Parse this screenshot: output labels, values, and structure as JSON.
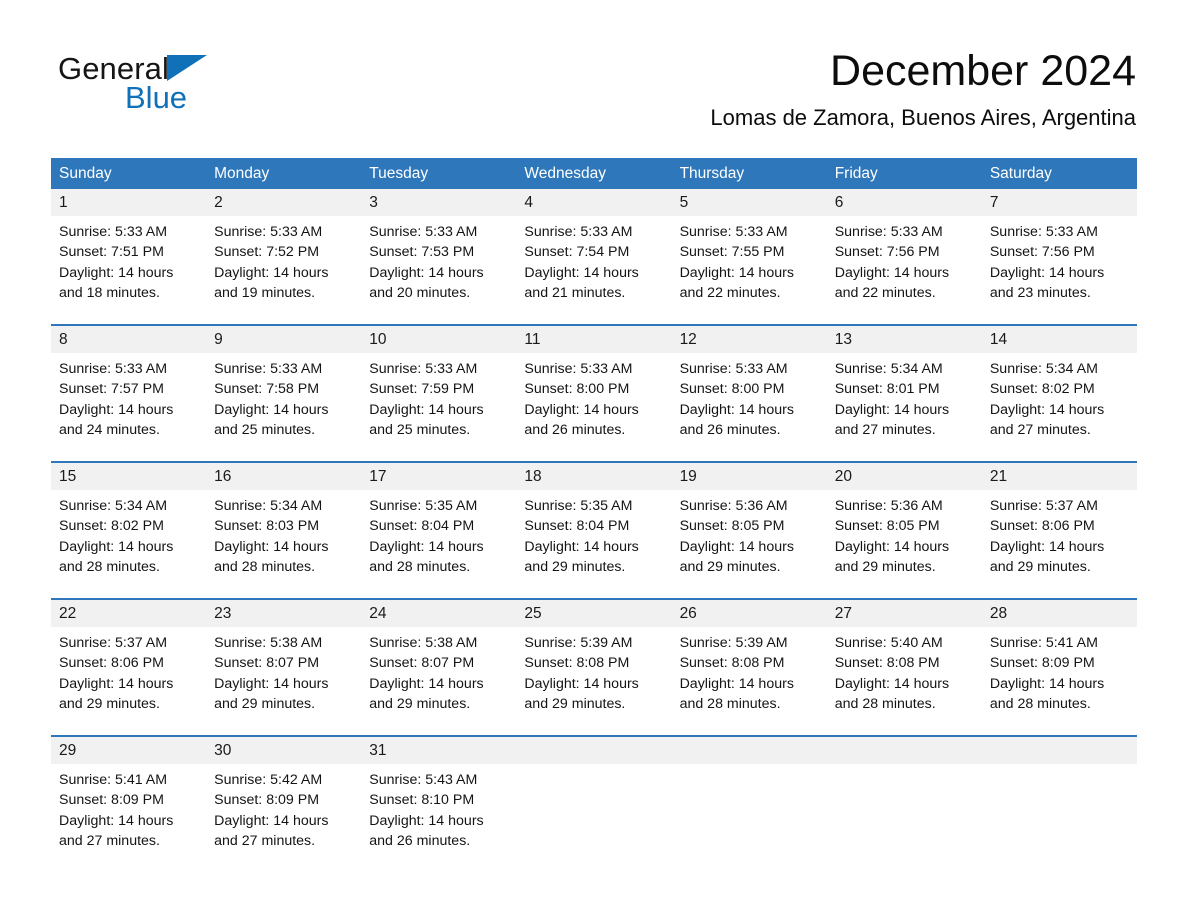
{
  "brand": {
    "name_part1": "General",
    "name_part2": "Blue",
    "triangle_color": "#1071b8",
    "text_color": "#151515"
  },
  "header": {
    "title": "December 2024",
    "subtitle": "Lomas de Zamora, Buenos Aires, Argentina"
  },
  "theme": {
    "header_blue": "#2e77ba",
    "row_separator_blue": "#2e77ba",
    "daynum_band_gray": "#f1f1f1",
    "page_background": "#ffffff",
    "text_color": "#141414"
  },
  "weekdays": [
    "Sunday",
    "Monday",
    "Tuesday",
    "Wednesday",
    "Thursday",
    "Friday",
    "Saturday"
  ],
  "weeks": [
    [
      {
        "day": "1",
        "sunrise": "Sunrise: 5:33 AM",
        "sunset": "Sunset: 7:51 PM",
        "daylight1": "Daylight: 14 hours",
        "daylight2": "and 18 minutes."
      },
      {
        "day": "2",
        "sunrise": "Sunrise: 5:33 AM",
        "sunset": "Sunset: 7:52 PM",
        "daylight1": "Daylight: 14 hours",
        "daylight2": "and 19 minutes."
      },
      {
        "day": "3",
        "sunrise": "Sunrise: 5:33 AM",
        "sunset": "Sunset: 7:53 PM",
        "daylight1": "Daylight: 14 hours",
        "daylight2": "and 20 minutes."
      },
      {
        "day": "4",
        "sunrise": "Sunrise: 5:33 AM",
        "sunset": "Sunset: 7:54 PM",
        "daylight1": "Daylight: 14 hours",
        "daylight2": "and 21 minutes."
      },
      {
        "day": "5",
        "sunrise": "Sunrise: 5:33 AM",
        "sunset": "Sunset: 7:55 PM",
        "daylight1": "Daylight: 14 hours",
        "daylight2": "and 22 minutes."
      },
      {
        "day": "6",
        "sunrise": "Sunrise: 5:33 AM",
        "sunset": "Sunset: 7:56 PM",
        "daylight1": "Daylight: 14 hours",
        "daylight2": "and 22 minutes."
      },
      {
        "day": "7",
        "sunrise": "Sunrise: 5:33 AM",
        "sunset": "Sunset: 7:56 PM",
        "daylight1": "Daylight: 14 hours",
        "daylight2": "and 23 minutes."
      }
    ],
    [
      {
        "day": "8",
        "sunrise": "Sunrise: 5:33 AM",
        "sunset": "Sunset: 7:57 PM",
        "daylight1": "Daylight: 14 hours",
        "daylight2": "and 24 minutes."
      },
      {
        "day": "9",
        "sunrise": "Sunrise: 5:33 AM",
        "sunset": "Sunset: 7:58 PM",
        "daylight1": "Daylight: 14 hours",
        "daylight2": "and 25 minutes."
      },
      {
        "day": "10",
        "sunrise": "Sunrise: 5:33 AM",
        "sunset": "Sunset: 7:59 PM",
        "daylight1": "Daylight: 14 hours",
        "daylight2": "and 25 minutes."
      },
      {
        "day": "11",
        "sunrise": "Sunrise: 5:33 AM",
        "sunset": "Sunset: 8:00 PM",
        "daylight1": "Daylight: 14 hours",
        "daylight2": "and 26 minutes."
      },
      {
        "day": "12",
        "sunrise": "Sunrise: 5:33 AM",
        "sunset": "Sunset: 8:00 PM",
        "daylight1": "Daylight: 14 hours",
        "daylight2": "and 26 minutes."
      },
      {
        "day": "13",
        "sunrise": "Sunrise: 5:34 AM",
        "sunset": "Sunset: 8:01 PM",
        "daylight1": "Daylight: 14 hours",
        "daylight2": "and 27 minutes."
      },
      {
        "day": "14",
        "sunrise": "Sunrise: 5:34 AM",
        "sunset": "Sunset: 8:02 PM",
        "daylight1": "Daylight: 14 hours",
        "daylight2": "and 27 minutes."
      }
    ],
    [
      {
        "day": "15",
        "sunrise": "Sunrise: 5:34 AM",
        "sunset": "Sunset: 8:02 PM",
        "daylight1": "Daylight: 14 hours",
        "daylight2": "and 28 minutes."
      },
      {
        "day": "16",
        "sunrise": "Sunrise: 5:34 AM",
        "sunset": "Sunset: 8:03 PM",
        "daylight1": "Daylight: 14 hours",
        "daylight2": "and 28 minutes."
      },
      {
        "day": "17",
        "sunrise": "Sunrise: 5:35 AM",
        "sunset": "Sunset: 8:04 PM",
        "daylight1": "Daylight: 14 hours",
        "daylight2": "and 28 minutes."
      },
      {
        "day": "18",
        "sunrise": "Sunrise: 5:35 AM",
        "sunset": "Sunset: 8:04 PM",
        "daylight1": "Daylight: 14 hours",
        "daylight2": "and 29 minutes."
      },
      {
        "day": "19",
        "sunrise": "Sunrise: 5:36 AM",
        "sunset": "Sunset: 8:05 PM",
        "daylight1": "Daylight: 14 hours",
        "daylight2": "and 29 minutes."
      },
      {
        "day": "20",
        "sunrise": "Sunrise: 5:36 AM",
        "sunset": "Sunset: 8:05 PM",
        "daylight1": "Daylight: 14 hours",
        "daylight2": "and 29 minutes."
      },
      {
        "day": "21",
        "sunrise": "Sunrise: 5:37 AM",
        "sunset": "Sunset: 8:06 PM",
        "daylight1": "Daylight: 14 hours",
        "daylight2": "and 29 minutes."
      }
    ],
    [
      {
        "day": "22",
        "sunrise": "Sunrise: 5:37 AM",
        "sunset": "Sunset: 8:06 PM",
        "daylight1": "Daylight: 14 hours",
        "daylight2": "and 29 minutes."
      },
      {
        "day": "23",
        "sunrise": "Sunrise: 5:38 AM",
        "sunset": "Sunset: 8:07 PM",
        "daylight1": "Daylight: 14 hours",
        "daylight2": "and 29 minutes."
      },
      {
        "day": "24",
        "sunrise": "Sunrise: 5:38 AM",
        "sunset": "Sunset: 8:07 PM",
        "daylight1": "Daylight: 14 hours",
        "daylight2": "and 29 minutes."
      },
      {
        "day": "25",
        "sunrise": "Sunrise: 5:39 AM",
        "sunset": "Sunset: 8:08 PM",
        "daylight1": "Daylight: 14 hours",
        "daylight2": "and 29 minutes."
      },
      {
        "day": "26",
        "sunrise": "Sunrise: 5:39 AM",
        "sunset": "Sunset: 8:08 PM",
        "daylight1": "Daylight: 14 hours",
        "daylight2": "and 28 minutes."
      },
      {
        "day": "27",
        "sunrise": "Sunrise: 5:40 AM",
        "sunset": "Sunset: 8:08 PM",
        "daylight1": "Daylight: 14 hours",
        "daylight2": "and 28 minutes."
      },
      {
        "day": "28",
        "sunrise": "Sunrise: 5:41 AM",
        "sunset": "Sunset: 8:09 PM",
        "daylight1": "Daylight: 14 hours",
        "daylight2": "and 28 minutes."
      }
    ],
    [
      {
        "day": "29",
        "sunrise": "Sunrise: 5:41 AM",
        "sunset": "Sunset: 8:09 PM",
        "daylight1": "Daylight: 14 hours",
        "daylight2": "and 27 minutes."
      },
      {
        "day": "30",
        "sunrise": "Sunrise: 5:42 AM",
        "sunset": "Sunset: 8:09 PM",
        "daylight1": "Daylight: 14 hours",
        "daylight2": "and 27 minutes."
      },
      {
        "day": "31",
        "sunrise": "Sunrise: 5:43 AM",
        "sunset": "Sunset: 8:10 PM",
        "daylight1": "Daylight: 14 hours",
        "daylight2": "and 26 minutes."
      },
      {
        "day": "",
        "sunrise": "",
        "sunset": "",
        "daylight1": "",
        "daylight2": ""
      },
      {
        "day": "",
        "sunrise": "",
        "sunset": "",
        "daylight1": "",
        "daylight2": ""
      },
      {
        "day": "",
        "sunrise": "",
        "sunset": "",
        "daylight1": "",
        "daylight2": ""
      },
      {
        "day": "",
        "sunrise": "",
        "sunset": "",
        "daylight1": "",
        "daylight2": ""
      }
    ]
  ]
}
